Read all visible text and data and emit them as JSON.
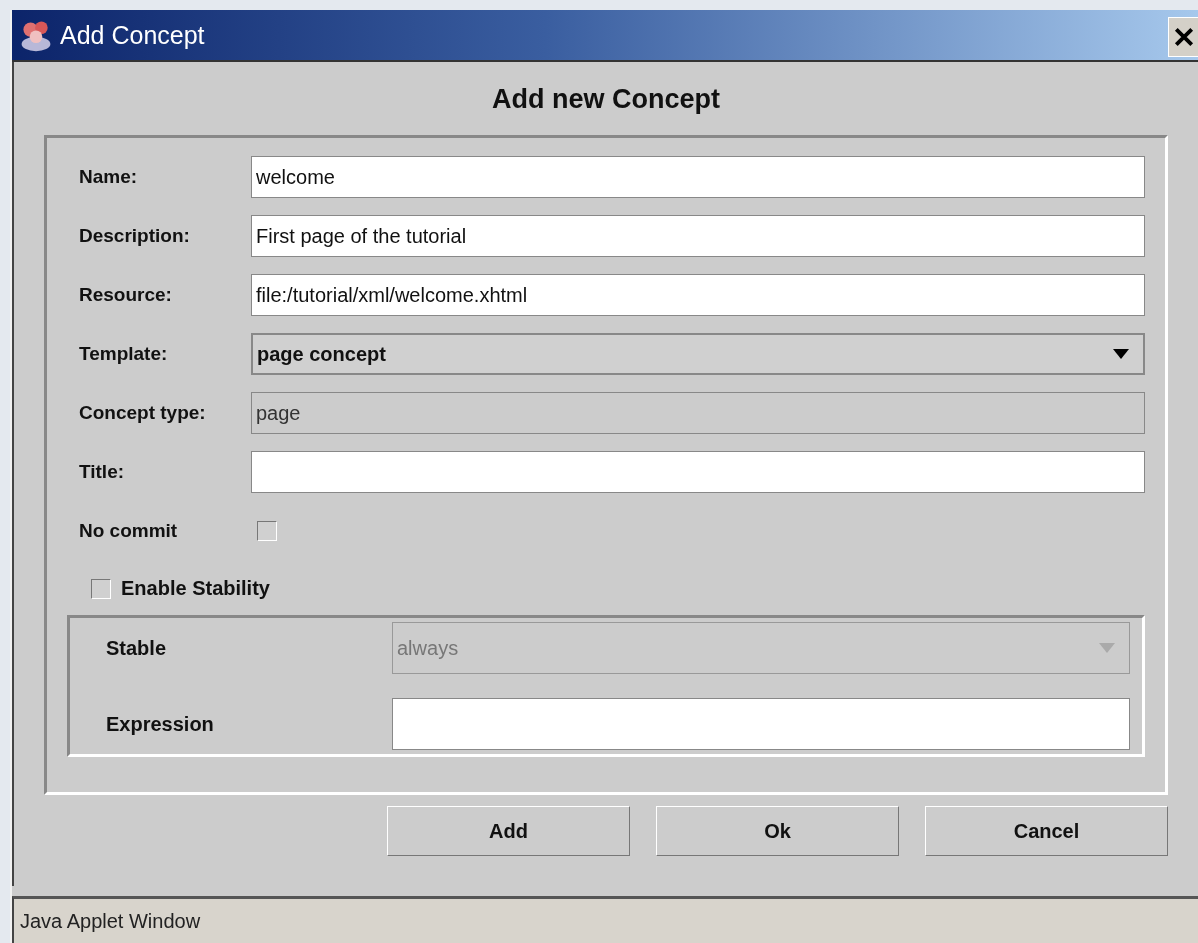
{
  "window": {
    "title": "Add Concept"
  },
  "heading": "Add new Concept",
  "fields": [
    {
      "kind": "text",
      "label": "Name:",
      "value": "welcome"
    },
    {
      "kind": "text",
      "label": "Description:",
      "value": "First page of the tutorial"
    },
    {
      "kind": "text",
      "label": "Resource:",
      "value": "file:/tutorial/xml/welcome.xhtml"
    },
    {
      "kind": "combo",
      "label": "Template:",
      "value": "page concept"
    },
    {
      "kind": "readonly",
      "label": "Concept type:",
      "value": "page"
    },
    {
      "kind": "text",
      "label": "Title:"
    }
  ],
  "no_commit": {
    "label": "No commit",
    "checked": false
  },
  "enable_stability": {
    "label": "Enable Stability",
    "checked": false
  },
  "stability": {
    "stable": {
      "label": "Stable",
      "value": "always",
      "disabled": true
    },
    "expression": {
      "label": "Expression"
    }
  },
  "buttons": [
    "Add",
    "Ok",
    "Cancel"
  ],
  "status_bar": "Java Applet Window"
}
